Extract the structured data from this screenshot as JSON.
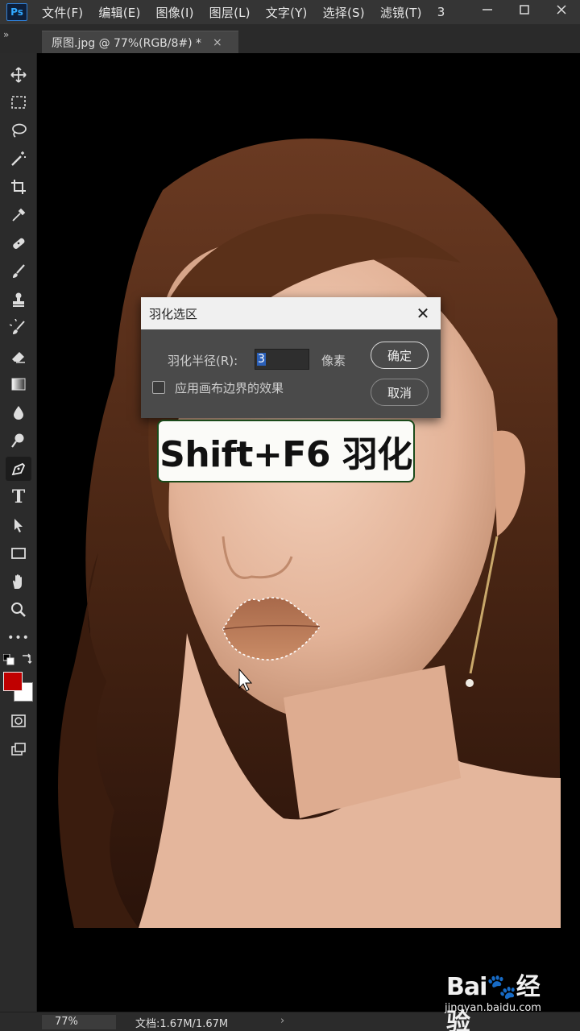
{
  "app": {
    "logo": "Ps"
  },
  "menu": [
    "文件(F)",
    "编辑(E)",
    "图像(I)",
    "图层(L)",
    "文字(Y)",
    "选择(S)",
    "滤镜(T)",
    "3"
  ],
  "window_controls": {
    "minimize": "—",
    "maximize": "☐",
    "close": "✕"
  },
  "panel_toggle": "»",
  "tab": {
    "title": "原图.jpg @ 77%(RGB/8#) *",
    "close": "×"
  },
  "toolbar": {
    "active_tool": "pen-tool",
    "tools": [
      "move",
      "marquee",
      "lasso",
      "magic-wand",
      "crop",
      "eyedropper",
      "healing-brush",
      "brush",
      "clone-stamp",
      "history-brush",
      "eraser",
      "gradient",
      "blur",
      "dodge",
      "pen",
      "type",
      "path-selection",
      "rectangle",
      "hand",
      "zoom",
      "more",
      "default-colors",
      "swap-colors",
      "foreground-color",
      "background-color",
      "quick-mask",
      "screen-mode"
    ],
    "type_glyph": "T",
    "more_glyph": "•••",
    "foreground_color": "#c00000",
    "background_color": "#ffffff"
  },
  "dialog": {
    "title": "羽化选区",
    "close": "✕",
    "radius_label": "羽化半径(R):",
    "radius_value": "3",
    "unit": "像素",
    "ok": "确定",
    "cancel": "取消",
    "checkbox_label": "应用画布边界的效果",
    "checkbox_checked": false
  },
  "caption": "Shift+F6 羽化",
  "status": {
    "zoom": "77%",
    "doc": "文档:1.67M/1.67M",
    "arrow": "›"
  },
  "watermark": {
    "brand": "Bai🐾经验",
    "url": "jingyan.baidu.com"
  },
  "colors": {
    "menubar": "#353535",
    "panel": "#2b2b2b",
    "canvas": "#000000",
    "accent": "#31a8ff"
  }
}
